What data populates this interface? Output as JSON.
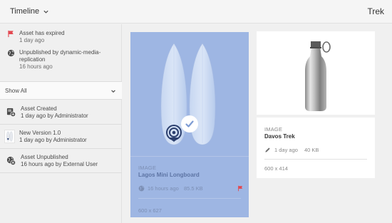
{
  "header": {
    "timeline_label": "Timeline",
    "title": "Trek"
  },
  "rail": {
    "alerts": [
      {
        "icon": "flag-icon",
        "title": "Asset has expired",
        "sub": "1 day ago"
      },
      {
        "icon": "globe-icon",
        "title": "Unpublished by dynamic-media-replication",
        "sub": "16 hours ago"
      }
    ],
    "filter": {
      "label": "Show All"
    },
    "events": [
      {
        "icon": "asset-created-icon",
        "title": "Asset Created",
        "sub": "1 day ago by Administrator"
      },
      {
        "icon": "version-thumbnail",
        "title": "New Version 1.0",
        "sub": "1 day ago by Administrator"
      },
      {
        "icon": "unpublish-icon",
        "title": "Asset Unpublished",
        "sub": "16 hours ago by External User"
      }
    ]
  },
  "cards": [
    {
      "selected": true,
      "type": "IMAGE",
      "name": "Lagos Mini Longboard",
      "modified": "16 hours ago",
      "size": "85.5 KB",
      "dimensions": "600 x 627"
    },
    {
      "selected": false,
      "type": "IMAGE",
      "name": "Davos Trek",
      "modified": "1 day ago",
      "size": "40 KB",
      "dimensions": "600 x 414"
    }
  ],
  "colors": {
    "selection": "#9eb6e3",
    "flag": "#e34850",
    "header_bg": "#f5f5f5"
  }
}
